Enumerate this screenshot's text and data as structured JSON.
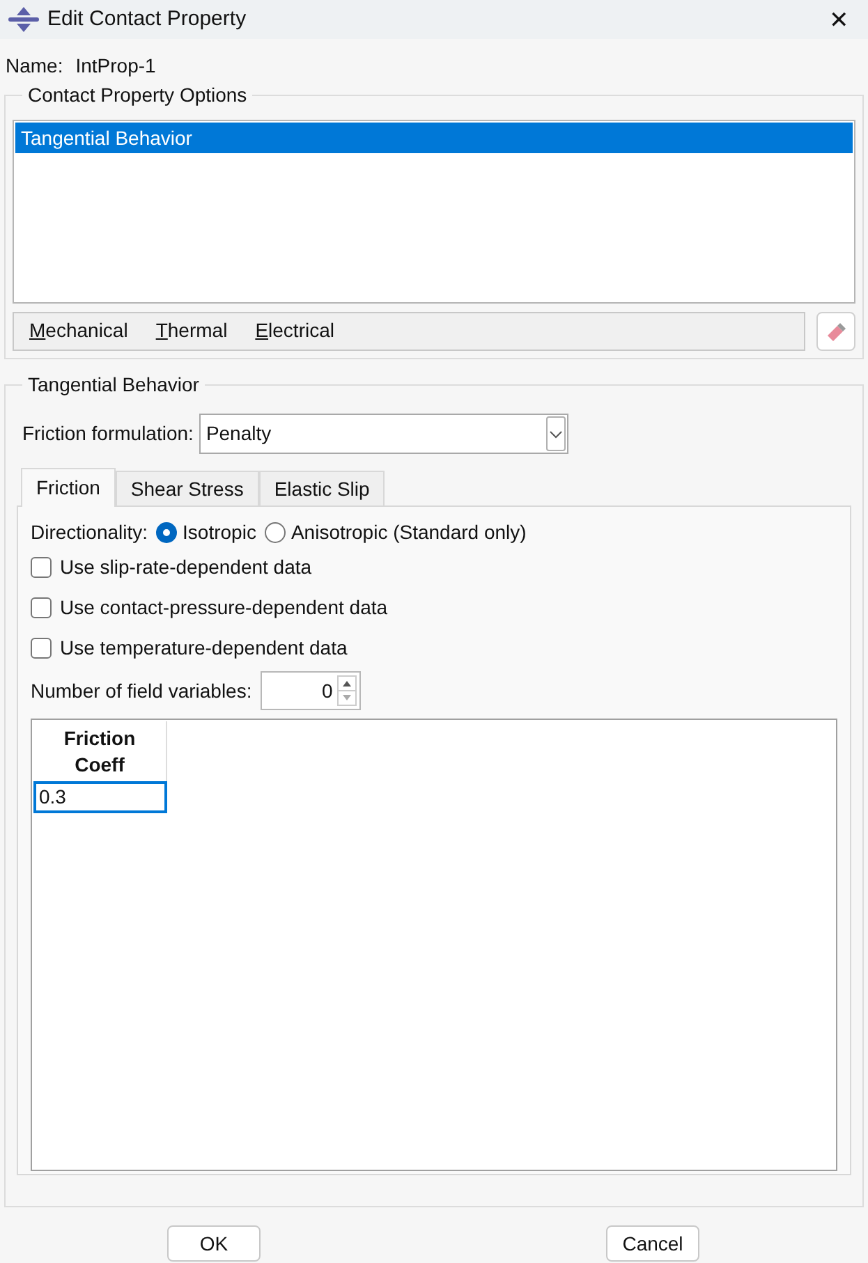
{
  "window": {
    "title": "Edit Contact Property",
    "close": "✕"
  },
  "name": {
    "label": "Name:",
    "value": "IntProp-1"
  },
  "options_group": {
    "title": "Contact Property Options",
    "items": [
      {
        "label": "Tangential Behavior",
        "selected": true
      }
    ],
    "menus": [
      {
        "label": "Mechanical",
        "underline_first": true
      },
      {
        "label": "Thermal",
        "underline_first": true
      },
      {
        "label": "Electrical",
        "underline_first": true
      }
    ]
  },
  "behavior_group": {
    "title": "Tangential Behavior",
    "formulation": {
      "label": "Friction formulation:",
      "value": "Penalty"
    },
    "tabs": [
      {
        "label": "Friction",
        "selected": true
      },
      {
        "label": "Shear Stress",
        "selected": false
      },
      {
        "label": "Elastic Slip",
        "selected": false
      }
    ],
    "directionality": {
      "label": "Directionality:",
      "options": [
        {
          "label": "Isotropic",
          "selected": true
        },
        {
          "label": "Anisotropic (Standard only)",
          "selected": false
        }
      ]
    },
    "checkboxes": [
      {
        "label": "Use slip-rate-dependent data",
        "checked": false
      },
      {
        "label": "Use contact-pressure-dependent data",
        "checked": false
      },
      {
        "label": "Use temperature-dependent data",
        "checked": false
      }
    ],
    "field_variables": {
      "label": "Number of field variables:",
      "value": "0"
    },
    "table": {
      "columns": [
        "Friction\nCoeff"
      ],
      "rows": [
        [
          "0.3"
        ]
      ]
    }
  },
  "buttons": [
    "OK",
    "Cancel"
  ]
}
